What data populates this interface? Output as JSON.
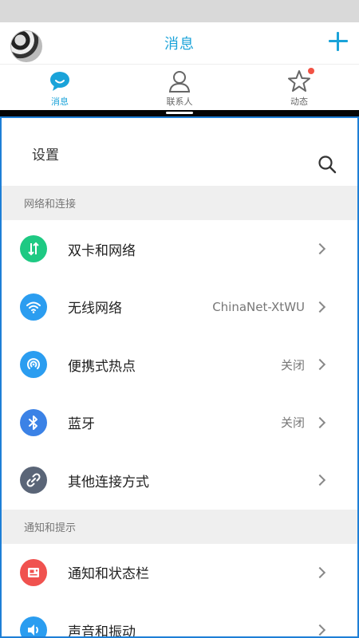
{
  "header": {
    "title": "消息"
  },
  "tabs": [
    {
      "label": "消息",
      "active": true
    },
    {
      "label": "联系人",
      "active": false
    },
    {
      "label": "动态",
      "active": false,
      "badge": true
    }
  ],
  "settings": {
    "title": "设置",
    "sections": [
      {
        "header": "网络和连接",
        "items": [
          {
            "label": "双卡和网络",
            "value": "",
            "icon": "dual-sim-icon",
            "color": "#1ec983"
          },
          {
            "label": "无线网络",
            "value": "ChinaNet-XtWU",
            "icon": "wifi-icon",
            "color": "#2b9df0"
          },
          {
            "label": "便携式热点",
            "value": "关闭",
            "icon": "hotspot-icon",
            "color": "#2b9df0"
          },
          {
            "label": "蓝牙",
            "value": "关闭",
            "icon": "bluetooth-icon",
            "color": "#3b82e6"
          },
          {
            "label": "其他连接方式",
            "value": "",
            "icon": "link-icon",
            "color": "#5a6577"
          }
        ]
      },
      {
        "header": "通知和提示",
        "items": [
          {
            "label": "通知和状态栏",
            "value": "",
            "icon": "notification-icon",
            "color": "#f0524f"
          },
          {
            "label": "声音和振动",
            "value": "",
            "icon": "sound-icon",
            "color": "#2b9df0"
          }
        ]
      }
    ]
  },
  "colors": {
    "accent": "#1aa3d9",
    "frame": "#1e7fd6"
  }
}
